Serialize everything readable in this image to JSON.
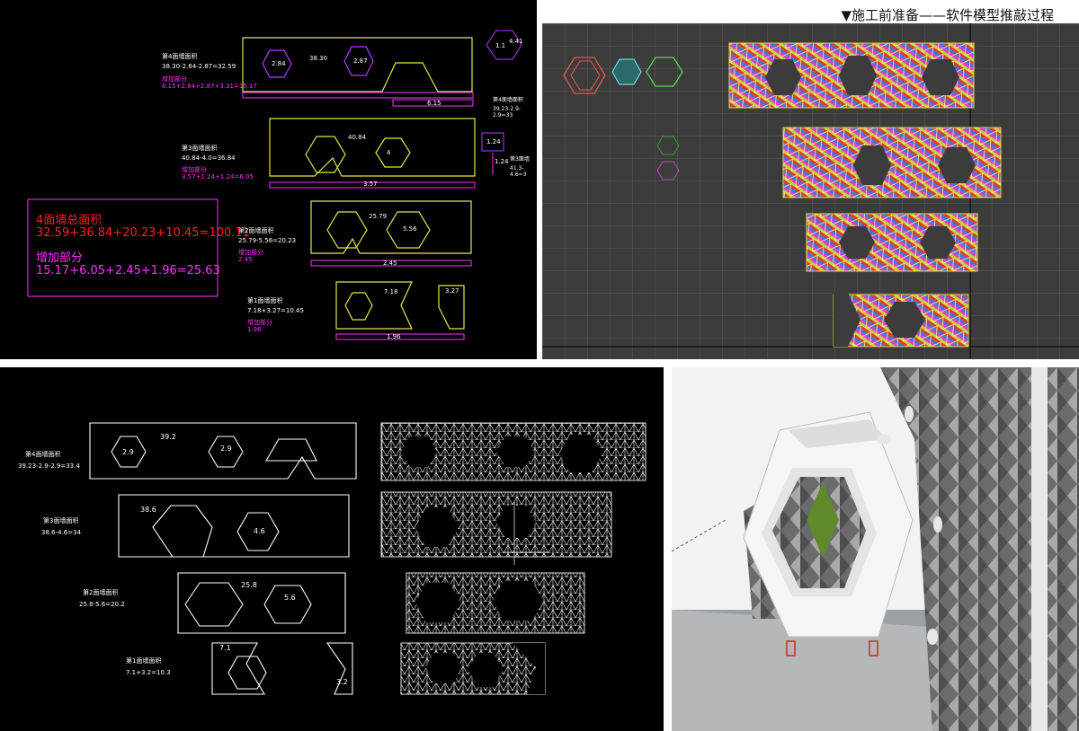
{
  "top_left": {
    "total_box": {
      "title": "4面墙总面积",
      "total": "32.59+36.84+20.23+10.45=100.11",
      "added_title": "增加部分",
      "added": "15.17+6.05+2.45+1.96=25.63"
    },
    "wall4": {
      "label": "第4面墙面积",
      "formula": "38.30-2.84-2.87=32.59",
      "added_label": "增加部分",
      "added": "6.15+2.84+2.87+3.31=15.17",
      "main": "38.30",
      "h1": "2.84",
      "h2": "2.87",
      "strip": "6.15",
      "side_hex": "4.41",
      "side_hex2": "1.1"
    },
    "wall3_side": {
      "label": "第4面墙面积",
      "formula": "39.23-2.9-2.9=33"
    },
    "wall3": {
      "label": "第3面墙面积",
      "formula": "40.84-4.0=36.84",
      "added_label": "增加部分",
      "added": "3.57+1.24+1.24=6.05",
      "main": "40.84",
      "h1": "4",
      "strip": "3.57",
      "side1": "1.24",
      "side2": "1.24"
    },
    "wall3_right": {
      "label": "第3面墙",
      "formula": "41.3-4.6=3"
    },
    "wall2": {
      "label": "第2面墙面积",
      "formula": "25.79-5.56=20.23",
      "added_label": "增加部分",
      "added": "2.45",
      "main": "25.79",
      "h1": "5.56",
      "strip": "2.45"
    },
    "wall1": {
      "label": "第1面墙面积",
      "formula": "7.18+3.27=10.45",
      "added_label": "增加部分",
      "added": "1.96",
      "main": "7.18",
      "side": "3.27",
      "strip": "1.96"
    }
  },
  "top_right": {
    "caption": "▼施工前准备——软件模型推敲过程"
  },
  "bottom_left": {
    "w4": {
      "label": "第4面墙面积",
      "formula": "39.23-2.9-2.9=33.4",
      "main": "39.2",
      "h1": "2.9",
      "h2": "2.9"
    },
    "w3": {
      "label": "第3面墙面积",
      "formula": "38.6-4.6=34",
      "main": "38.6",
      "h1": "4.6"
    },
    "w2": {
      "label": "第2面墙面积",
      "formula": "25.8-5.6=20.2",
      "main": "25.8",
      "h1": "5.6"
    },
    "w1": {
      "label": "第1面墙面积",
      "formula": "7.1+3.2=10.3",
      "main": "7.1",
      "side": "3.2"
    }
  },
  "colors": {
    "cad_yellow": "#e6e64a",
    "cad_magenta": "#ff30ff",
    "cad_red": "#ff2020",
    "cad_white": "#ffffff",
    "viewport": "#3c3c3c"
  }
}
